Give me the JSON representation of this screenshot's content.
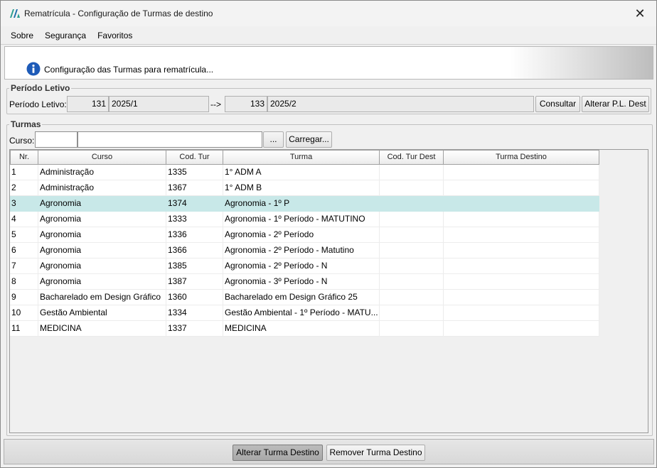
{
  "window": {
    "title": "Rematrícula - Configuração de Turmas de destino",
    "close_glyph": "✕"
  },
  "menu": {
    "items": [
      "Sobre",
      "Segurança",
      "Favoritos"
    ]
  },
  "banner": {
    "text": "Configuração das Turmas para rematrícula..."
  },
  "periodo": {
    "group_title": "Período Letivo",
    "label": "Período Letivo:",
    "from_code": "131",
    "from_name": "2025/1",
    "arrow": "-->",
    "to_code": "133",
    "to_name": "2025/2",
    "consultar_label": "Consultar",
    "alterar_pl_label": "Alterar P.L. Dest"
  },
  "turmas": {
    "group_title": "Turmas",
    "curso_label": "Curso:",
    "curso_code_value": "",
    "curso_name_value": "",
    "browse_label": "...",
    "carregar_label": "Carregar..."
  },
  "grid": {
    "columns": [
      "Nr.",
      "Curso",
      "Cod. Tur",
      "Turma",
      "Cod. Tur Dest",
      "Turma Destino"
    ],
    "selected_row": 2,
    "rows": [
      {
        "nr": "1",
        "curso": "Administração",
        "cod_tur": "1335",
        "turma": "1° ADM A",
        "cod_tur_dest": "",
        "turma_destino": ""
      },
      {
        "nr": "2",
        "curso": "Administração",
        "cod_tur": "1367",
        "turma": "1° ADM B",
        "cod_tur_dest": "",
        "turma_destino": ""
      },
      {
        "nr": "3",
        "curso": "Agronomia",
        "cod_tur": "1374",
        "turma": "Agronomia - 1º P",
        "cod_tur_dest": "",
        "turma_destino": ""
      },
      {
        "nr": "4",
        "curso": "Agronomia",
        "cod_tur": "1333",
        "turma": "Agronomia - 1º Período - MATUTINO",
        "cod_tur_dest": "",
        "turma_destino": ""
      },
      {
        "nr": "5",
        "curso": "Agronomia",
        "cod_tur": "1336",
        "turma": "Agronomia - 2º Período",
        "cod_tur_dest": "",
        "turma_destino": ""
      },
      {
        "nr": "6",
        "curso": "Agronomia",
        "cod_tur": "1366",
        "turma": "Agronomia - 2º Período - Matutino",
        "cod_tur_dest": "",
        "turma_destino": ""
      },
      {
        "nr": "7",
        "curso": "Agronomia",
        "cod_tur": "1385",
        "turma": "Agronomia - 2º Período - N",
        "cod_tur_dest": "",
        "turma_destino": ""
      },
      {
        "nr": "8",
        "curso": "Agronomia",
        "cod_tur": "1387",
        "turma": "Agronomia - 3º Período - N",
        "cod_tur_dest": "",
        "turma_destino": ""
      },
      {
        "nr": "9",
        "curso": "Bacharelado em Design Gráfico",
        "cod_tur": "1360",
        "turma": "Bacharelado em Design Gráfico 25",
        "cod_tur_dest": "",
        "turma_destino": ""
      },
      {
        "nr": "10",
        "curso": "Gestão Ambiental",
        "cod_tur": "1334",
        "turma": "Gestão Ambiental - 1º Período - MATU...",
        "cod_tur_dest": "",
        "turma_destino": ""
      },
      {
        "nr": "11",
        "curso": "MEDICINA",
        "cod_tur": "1337",
        "turma": "MEDICINA",
        "cod_tur_dest": "",
        "turma_destino": ""
      }
    ]
  },
  "footer": {
    "alterar_label": "Alterar Turma Destino",
    "remover_label": "Remover Turma Destino"
  },
  "colors": {
    "selected_row": "#c8e8e8",
    "info_icon": "#1e5bb8",
    "app_icon": "#2a9d8f"
  }
}
